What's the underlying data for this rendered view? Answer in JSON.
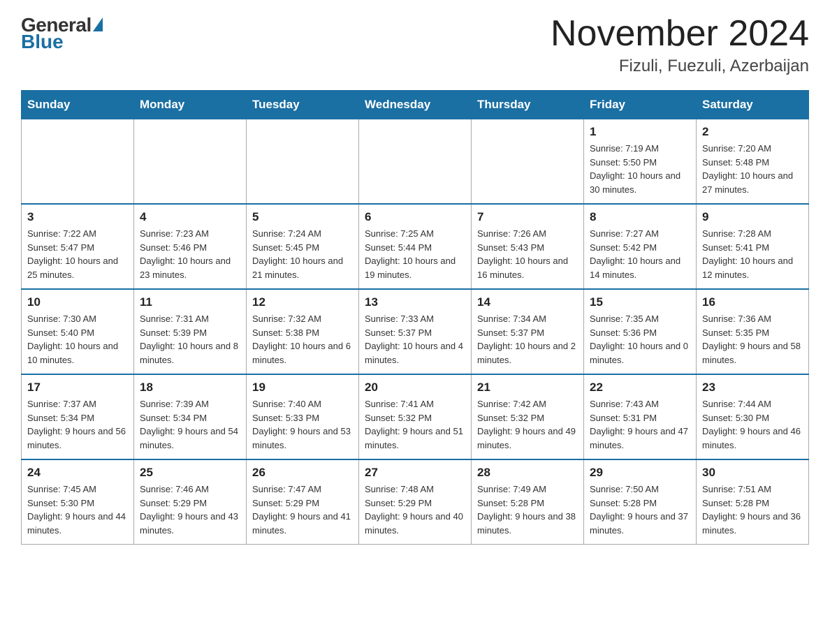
{
  "header": {
    "logo_general": "General",
    "logo_blue": "Blue",
    "month_title": "November 2024",
    "location": "Fizuli, Fuezuli, Azerbaijan"
  },
  "weekdays": [
    "Sunday",
    "Monday",
    "Tuesday",
    "Wednesday",
    "Thursday",
    "Friday",
    "Saturday"
  ],
  "weeks": [
    [
      {
        "day": "",
        "sunrise": "",
        "sunset": "",
        "daylight": ""
      },
      {
        "day": "",
        "sunrise": "",
        "sunset": "",
        "daylight": ""
      },
      {
        "day": "",
        "sunrise": "",
        "sunset": "",
        "daylight": ""
      },
      {
        "day": "",
        "sunrise": "",
        "sunset": "",
        "daylight": ""
      },
      {
        "day": "",
        "sunrise": "",
        "sunset": "",
        "daylight": ""
      },
      {
        "day": "1",
        "sunrise": "Sunrise: 7:19 AM",
        "sunset": "Sunset: 5:50 PM",
        "daylight": "Daylight: 10 hours and 30 minutes."
      },
      {
        "day": "2",
        "sunrise": "Sunrise: 7:20 AM",
        "sunset": "Sunset: 5:48 PM",
        "daylight": "Daylight: 10 hours and 27 minutes."
      }
    ],
    [
      {
        "day": "3",
        "sunrise": "Sunrise: 7:22 AM",
        "sunset": "Sunset: 5:47 PM",
        "daylight": "Daylight: 10 hours and 25 minutes."
      },
      {
        "day": "4",
        "sunrise": "Sunrise: 7:23 AM",
        "sunset": "Sunset: 5:46 PM",
        "daylight": "Daylight: 10 hours and 23 minutes."
      },
      {
        "day": "5",
        "sunrise": "Sunrise: 7:24 AM",
        "sunset": "Sunset: 5:45 PM",
        "daylight": "Daylight: 10 hours and 21 minutes."
      },
      {
        "day": "6",
        "sunrise": "Sunrise: 7:25 AM",
        "sunset": "Sunset: 5:44 PM",
        "daylight": "Daylight: 10 hours and 19 minutes."
      },
      {
        "day": "7",
        "sunrise": "Sunrise: 7:26 AM",
        "sunset": "Sunset: 5:43 PM",
        "daylight": "Daylight: 10 hours and 16 minutes."
      },
      {
        "day": "8",
        "sunrise": "Sunrise: 7:27 AM",
        "sunset": "Sunset: 5:42 PM",
        "daylight": "Daylight: 10 hours and 14 minutes."
      },
      {
        "day": "9",
        "sunrise": "Sunrise: 7:28 AM",
        "sunset": "Sunset: 5:41 PM",
        "daylight": "Daylight: 10 hours and 12 minutes."
      }
    ],
    [
      {
        "day": "10",
        "sunrise": "Sunrise: 7:30 AM",
        "sunset": "Sunset: 5:40 PM",
        "daylight": "Daylight: 10 hours and 10 minutes."
      },
      {
        "day": "11",
        "sunrise": "Sunrise: 7:31 AM",
        "sunset": "Sunset: 5:39 PM",
        "daylight": "Daylight: 10 hours and 8 minutes."
      },
      {
        "day": "12",
        "sunrise": "Sunrise: 7:32 AM",
        "sunset": "Sunset: 5:38 PM",
        "daylight": "Daylight: 10 hours and 6 minutes."
      },
      {
        "day": "13",
        "sunrise": "Sunrise: 7:33 AM",
        "sunset": "Sunset: 5:37 PM",
        "daylight": "Daylight: 10 hours and 4 minutes."
      },
      {
        "day": "14",
        "sunrise": "Sunrise: 7:34 AM",
        "sunset": "Sunset: 5:37 PM",
        "daylight": "Daylight: 10 hours and 2 minutes."
      },
      {
        "day": "15",
        "sunrise": "Sunrise: 7:35 AM",
        "sunset": "Sunset: 5:36 PM",
        "daylight": "Daylight: 10 hours and 0 minutes."
      },
      {
        "day": "16",
        "sunrise": "Sunrise: 7:36 AM",
        "sunset": "Sunset: 5:35 PM",
        "daylight": "Daylight: 9 hours and 58 minutes."
      }
    ],
    [
      {
        "day": "17",
        "sunrise": "Sunrise: 7:37 AM",
        "sunset": "Sunset: 5:34 PM",
        "daylight": "Daylight: 9 hours and 56 minutes."
      },
      {
        "day": "18",
        "sunrise": "Sunrise: 7:39 AM",
        "sunset": "Sunset: 5:34 PM",
        "daylight": "Daylight: 9 hours and 54 minutes."
      },
      {
        "day": "19",
        "sunrise": "Sunrise: 7:40 AM",
        "sunset": "Sunset: 5:33 PM",
        "daylight": "Daylight: 9 hours and 53 minutes."
      },
      {
        "day": "20",
        "sunrise": "Sunrise: 7:41 AM",
        "sunset": "Sunset: 5:32 PM",
        "daylight": "Daylight: 9 hours and 51 minutes."
      },
      {
        "day": "21",
        "sunrise": "Sunrise: 7:42 AM",
        "sunset": "Sunset: 5:32 PM",
        "daylight": "Daylight: 9 hours and 49 minutes."
      },
      {
        "day": "22",
        "sunrise": "Sunrise: 7:43 AM",
        "sunset": "Sunset: 5:31 PM",
        "daylight": "Daylight: 9 hours and 47 minutes."
      },
      {
        "day": "23",
        "sunrise": "Sunrise: 7:44 AM",
        "sunset": "Sunset: 5:30 PM",
        "daylight": "Daylight: 9 hours and 46 minutes."
      }
    ],
    [
      {
        "day": "24",
        "sunrise": "Sunrise: 7:45 AM",
        "sunset": "Sunset: 5:30 PM",
        "daylight": "Daylight: 9 hours and 44 minutes."
      },
      {
        "day": "25",
        "sunrise": "Sunrise: 7:46 AM",
        "sunset": "Sunset: 5:29 PM",
        "daylight": "Daylight: 9 hours and 43 minutes."
      },
      {
        "day": "26",
        "sunrise": "Sunrise: 7:47 AM",
        "sunset": "Sunset: 5:29 PM",
        "daylight": "Daylight: 9 hours and 41 minutes."
      },
      {
        "day": "27",
        "sunrise": "Sunrise: 7:48 AM",
        "sunset": "Sunset: 5:29 PM",
        "daylight": "Daylight: 9 hours and 40 minutes."
      },
      {
        "day": "28",
        "sunrise": "Sunrise: 7:49 AM",
        "sunset": "Sunset: 5:28 PM",
        "daylight": "Daylight: 9 hours and 38 minutes."
      },
      {
        "day": "29",
        "sunrise": "Sunrise: 7:50 AM",
        "sunset": "Sunset: 5:28 PM",
        "daylight": "Daylight: 9 hours and 37 minutes."
      },
      {
        "day": "30",
        "sunrise": "Sunrise: 7:51 AM",
        "sunset": "Sunset: 5:28 PM",
        "daylight": "Daylight: 9 hours and 36 minutes."
      }
    ]
  ]
}
